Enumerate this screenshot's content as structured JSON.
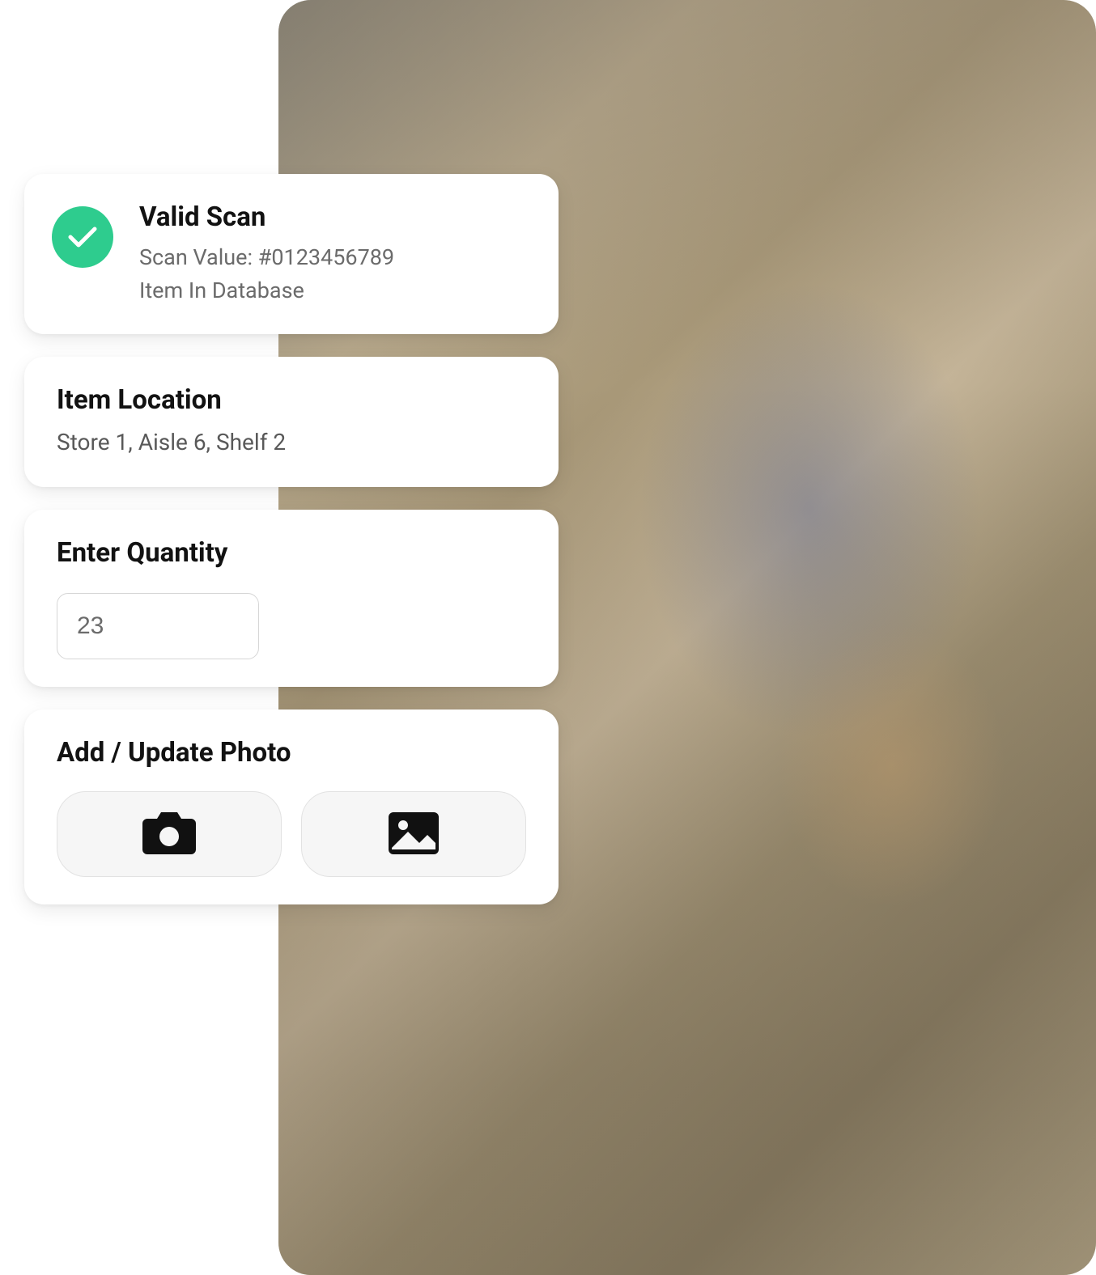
{
  "scan": {
    "title": "Valid Scan",
    "value_line": "Scan Value: #0123456789",
    "status_line": "Item In Database",
    "check_color": "#2ecc8e"
  },
  "location": {
    "title": "Item Location",
    "value": "Store 1, Aisle 6, Shelf 2"
  },
  "quantity": {
    "title": "Enter Quantity",
    "value": "23"
  },
  "photo": {
    "title": "Add / Update Photo",
    "camera_icon": "camera-icon",
    "image_icon": "image-icon"
  }
}
